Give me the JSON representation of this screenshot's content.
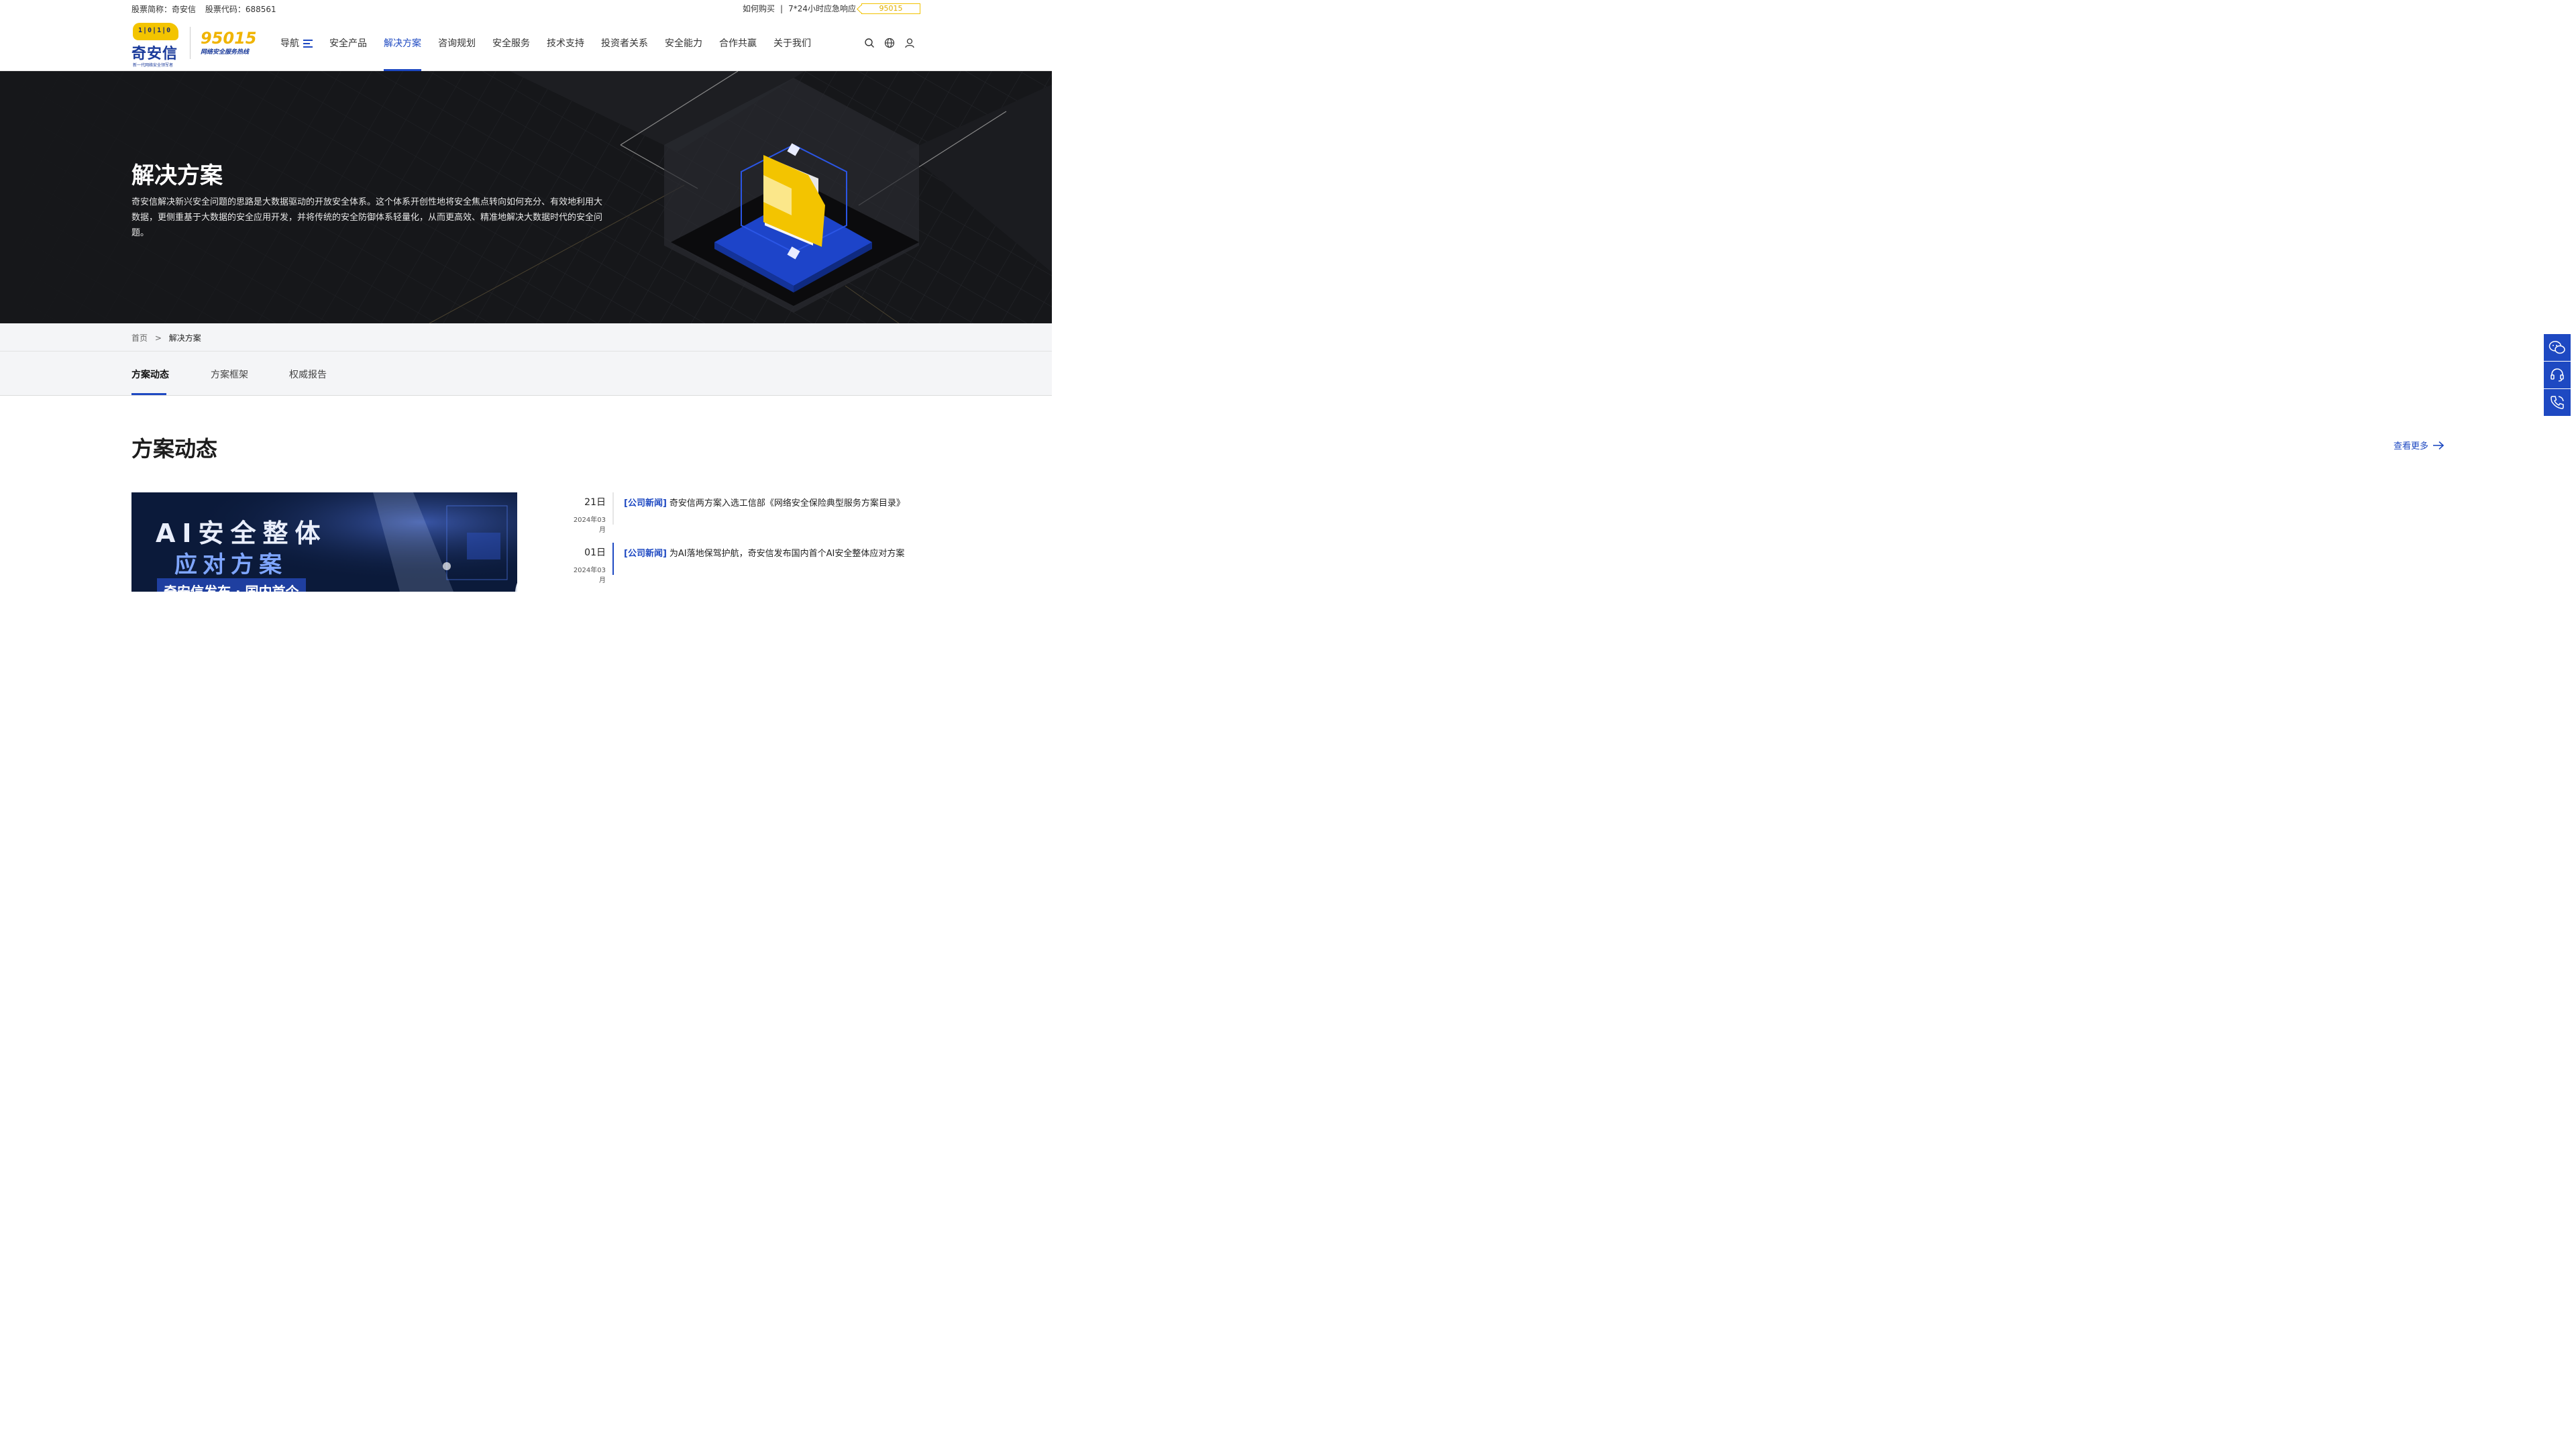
{
  "topbar": {
    "stock_name": "股票简称：奇安信",
    "stock_code": "股票代码：688561",
    "buy_link": "如何购买",
    "separator": "|",
    "emergency": "7*24小时应急响应",
    "hotline_badge": "95015"
  },
  "header": {
    "logo_text": "奇安信",
    "logo_bits": "1|0|1|0",
    "logo_slogan": "新一代网络安全领军者",
    "hotline_number": "95015",
    "hotline_label": "网络安全服务热线",
    "nav": [
      {
        "label": "导航",
        "active": false
      },
      {
        "label": "安全产品",
        "active": false
      },
      {
        "label": "解决方案",
        "active": true
      },
      {
        "label": "咨询规划",
        "active": false
      },
      {
        "label": "安全服务",
        "active": false
      },
      {
        "label": "技术支持",
        "active": false
      },
      {
        "label": "投资者关系",
        "active": false
      },
      {
        "label": "安全能力",
        "active": false
      },
      {
        "label": "合作共赢",
        "active": false
      },
      {
        "label": "关于我们",
        "active": false
      }
    ],
    "icons": [
      "search-icon",
      "globe-icon",
      "user-icon"
    ]
  },
  "hero": {
    "title": "解决方案",
    "description": "奇安信解决新兴安全问题的思路是大数据驱动的开放安全体系。这个体系开创性地将安全焦点转向如何充分、有效地利用大数据，更侧重基于大数据的安全应用开发，并将传统的安全防御体系轻量化，从而更高效、精准地解决大数据时代的安全问题。"
  },
  "breadcrumb": {
    "home": "首页",
    "sep": ">",
    "current": "解决方案"
  },
  "tabs": [
    {
      "label": "方案动态",
      "active": true
    },
    {
      "label": "方案框架",
      "active": false
    },
    {
      "label": "权威报告",
      "active": false
    }
  ],
  "section": {
    "title": "方案动态",
    "more": "查看更多"
  },
  "feature": {
    "line1": "AI安全整体",
    "line2": "应对方案",
    "line3": "奇安信发布 · 国内首个"
  },
  "news": [
    {
      "day": "21日",
      "month": "2024年03月",
      "tag": "[公司新闻]",
      "title": "奇安信两方案入选工信部《网络安全保险典型服务方案目录》"
    },
    {
      "day": "01日",
      "month": "2024年03月",
      "tag": "[公司新闻]",
      "title": "为AI落地保驾护航，奇安信发布国内首个AI安全整体应对方案"
    }
  ],
  "side_buttons": [
    "wechat-icon",
    "customer-service-icon",
    "phone-icon"
  ],
  "colors": {
    "brand_blue": "#1e49c2",
    "brand_yellow": "#f3c400",
    "hero_bg": "#16171a"
  }
}
